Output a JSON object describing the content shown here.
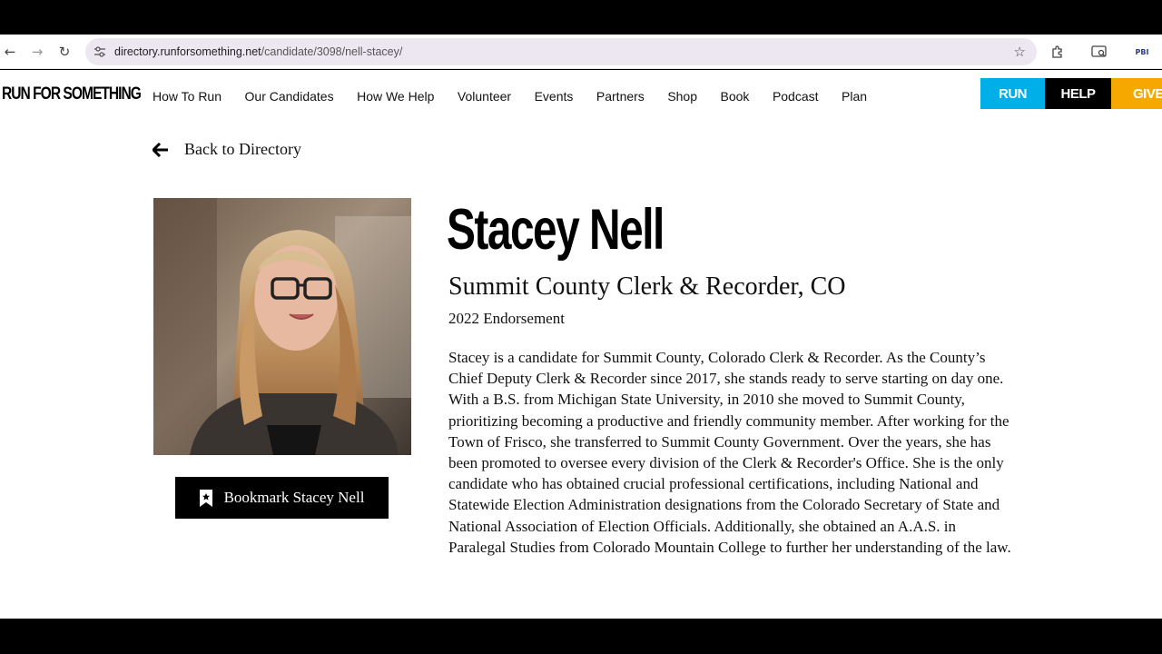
{
  "browser": {
    "url_host": "directory.runforsomething.net",
    "url_path": "/candidate/3098/nell-stacey/",
    "back_icon": "←",
    "forward_icon": "→",
    "reload_icon": "↻",
    "star_icon": "☆",
    "extension_label": "PBI"
  },
  "site": {
    "logo": "RUN FOR SOMETHING",
    "nav": [
      "How To Run",
      "Our Candidates",
      "How We Help",
      "Volunteer",
      "Events",
      "Partners",
      "Shop",
      "Book",
      "Podcast",
      "Plan"
    ],
    "cta": {
      "run": "RUN",
      "help": "HELP",
      "give": "GIVE"
    },
    "colors": {
      "run": "#00aee8",
      "help": "#000000",
      "give": "#f7a800"
    }
  },
  "back_link": "Back to Directory",
  "candidate": {
    "name": "Stacey Nell",
    "office": "Summit County Clerk & Recorder, CO",
    "endorsement": "2022 Endorsement",
    "bookmark_label": "Bookmark Stacey Nell",
    "bio": "Stacey is a candidate for Summit County, Colorado Clerk & Recorder. As the County’s Chief Deputy Clerk & Recorder since 2017, she stands ready to serve starting on day one. With a B.S. from Michigan State University, in 2010 she moved to Summit County, prioritizing becoming a productive and friendly community member. After working for the Town of Frisco, she transferred to Summit County Government. Over the years, she has been promoted to oversee every division of the Clerk & Recorder's Office. She is the only candidate who has obtained crucial professional certifications, including National and Statewide Election Administration designations from the Colorado Secretary of State and National Association of Election Officials. Additionally, she obtained an A.A.S. in Paralegal Studies from Colorado Mountain College to further her understanding of the law."
  }
}
